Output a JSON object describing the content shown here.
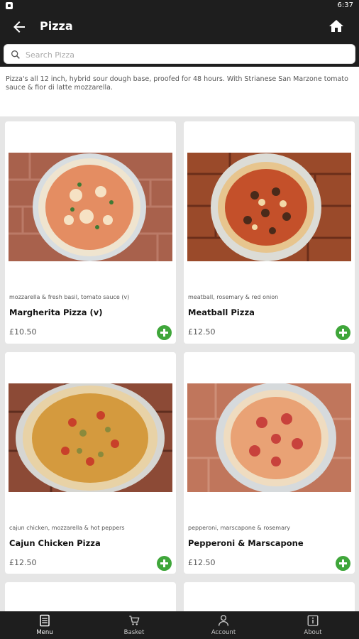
{
  "status_bar": {
    "time": "6:37"
  },
  "header": {
    "title": "Pizza"
  },
  "search": {
    "placeholder": "Search Pizza",
    "value": ""
  },
  "description": "Pizza's all 12 inch, hybrid sour dough base, proofed for 48 hours. With Strianese San Marzone tomato sauce & fior di latte mozzarella.",
  "products": [
    {
      "subtitle": "mozzarella & fresh basil, tomato sauce (v)",
      "name": "Margherita Pizza (v)",
      "price": "£10.50"
    },
    {
      "subtitle": "meatball, rosemary & red onion",
      "name": "Meatball Pizza",
      "price": "£12.50"
    },
    {
      "subtitle": "cajun chicken, mozzarella & hot peppers",
      "name": "Cajun Chicken Pizza",
      "price": "£12.50"
    },
    {
      "subtitle": "pepperoni, marscapone & rosemary",
      "name": "Pepperoni & Marscapone",
      "price": "£12.50"
    }
  ],
  "nav": [
    {
      "label": "Menu",
      "icon": "menu-icon",
      "active": true
    },
    {
      "label": "Basket",
      "icon": "basket-icon",
      "active": false
    },
    {
      "label": "Account",
      "icon": "account-icon",
      "active": false
    },
    {
      "label": "About",
      "icon": "about-icon",
      "active": false
    }
  ],
  "colors": {
    "bar": "#1e1e1e",
    "add_button": "#3fa63a"
  }
}
